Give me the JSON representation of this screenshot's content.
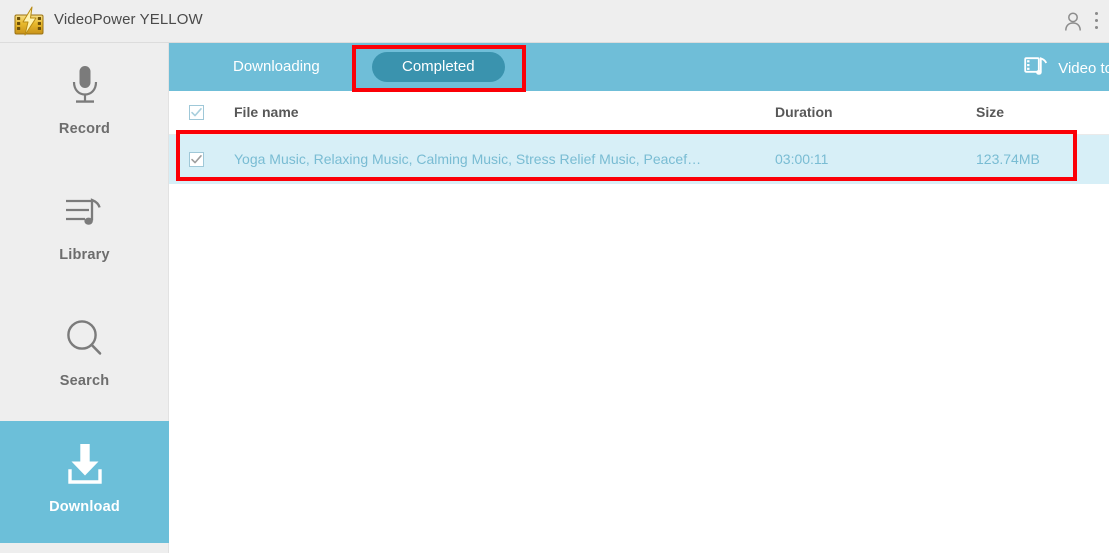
{
  "titlebar": {
    "app_name": "VideoPower YELLOW",
    "logo_icon": "videopower-filmstrip-lightning-logo",
    "user_icon": "user-account-icon",
    "menu_icon": "overflow-menu-icon"
  },
  "sidebar": {
    "items": [
      {
        "label": "Record",
        "icon": "microphone-icon",
        "active": false
      },
      {
        "label": "Library",
        "icon": "playlist-music-icon",
        "active": false
      },
      {
        "label": "Search",
        "icon": "search-icon",
        "active": false
      },
      {
        "label": "Download",
        "icon": "download-arrow-icon",
        "active": true
      }
    ]
  },
  "main": {
    "tabs": [
      {
        "label": "Downloading",
        "active": false
      },
      {
        "label": "Completed",
        "active": true
      }
    ],
    "video_to": {
      "label": "Video to",
      "icon": "video-to-audio-convert-icon"
    },
    "table": {
      "columns": [
        "File name",
        "Duration",
        "Size"
      ],
      "select_all_checked": true,
      "rows": [
        {
          "checked": true,
          "file_name": "Yoga Music, Relaxing Music, Calming Music, Stress Relief Music, Peacef…",
          "duration": "03:00:11",
          "size": "123.74MB"
        }
      ]
    }
  },
  "colors": {
    "accent_blue": "#6fbed8",
    "active_tab": "#3a93ae",
    "row_highlight": "#d7eff7",
    "annotation_red": "#fb0007",
    "chrome_gray": "#eeeeee"
  },
  "annotations": [
    {
      "name": "completed-tab-highlight",
      "target": "Completed"
    },
    {
      "name": "completed-row-highlight",
      "target": "Yoga Music row"
    }
  ]
}
